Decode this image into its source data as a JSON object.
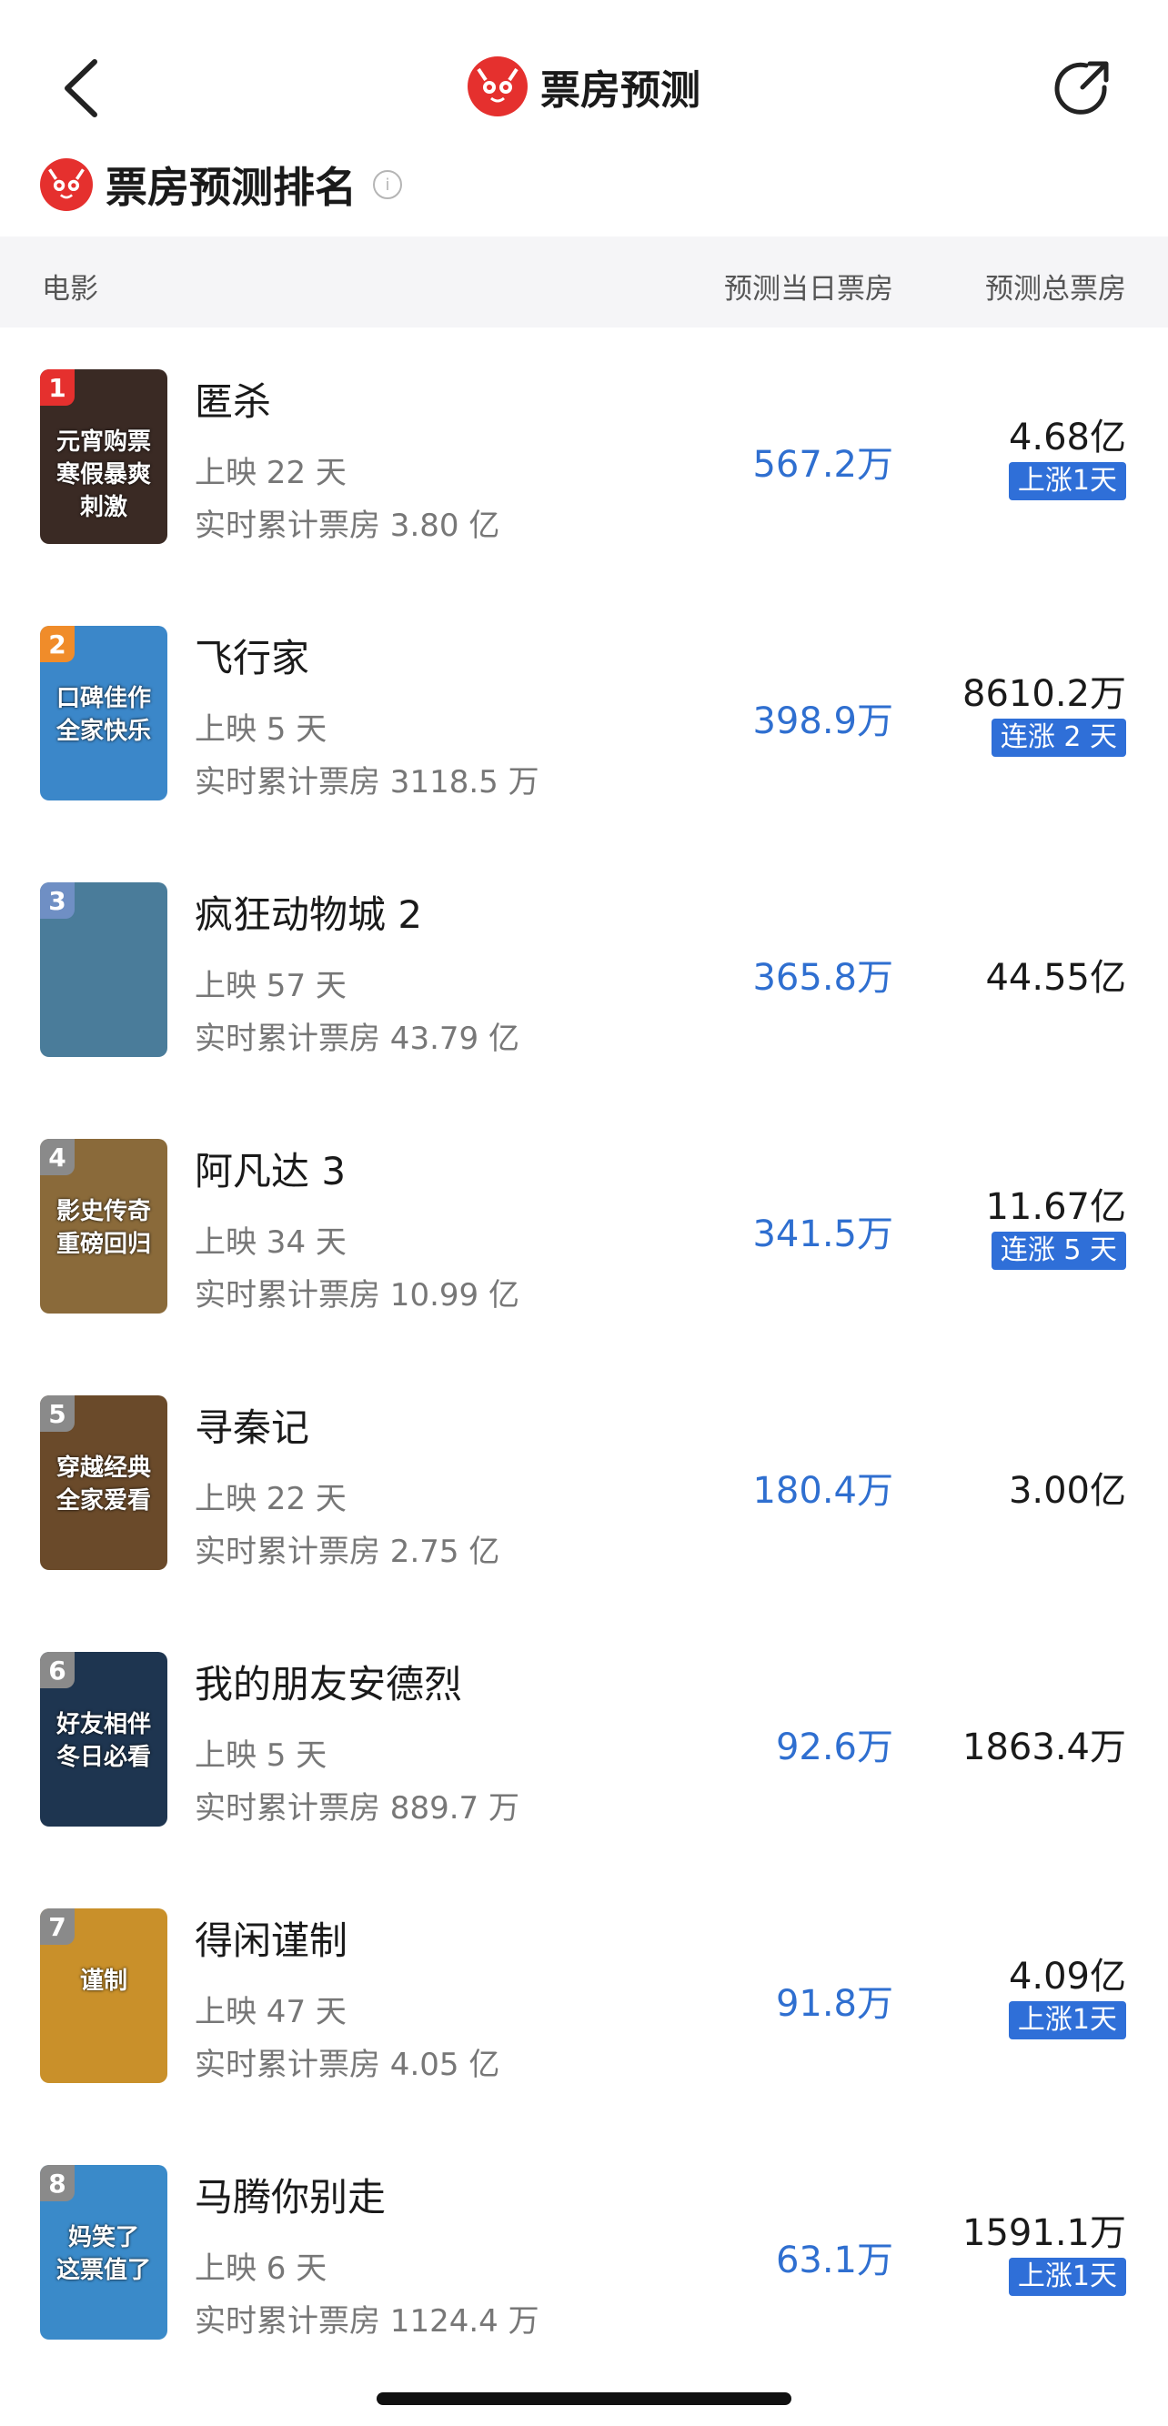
{
  "nav": {
    "title": "票房预测"
  },
  "section": {
    "title": "票房预测排名",
    "info": "i"
  },
  "columns": {
    "movie": "电影",
    "today": "预测当日票房",
    "total": "预测总票房"
  },
  "colors": {
    "accent": "#e5302e",
    "link_blue": "#2f6fd0",
    "badge_blue": "#2f6fd8"
  },
  "movies": [
    {
      "rank": "1",
      "title": "匿杀",
      "days": "上映 22 天",
      "cum": "实时累计票房 3.80 亿",
      "today": "567.2万",
      "total": "4.68亿",
      "badge": "上涨1天",
      "poster_text": "元宵购票\n寒假暴爽刺激",
      "rank_color": "#e5302e",
      "poster_bg": "#3a2a24"
    },
    {
      "rank": "2",
      "title": "飞行家",
      "days": "上映 5 天",
      "cum": "实时累计票房 3118.5 万",
      "today": "398.9万",
      "total": "8610.2万",
      "badge": "连涨 2 天",
      "poster_text": "口碑佳作\n全家快乐",
      "rank_color": "#f08c2a",
      "poster_bg": "#3b87c9"
    },
    {
      "rank": "3",
      "title": "疯狂动物城 2",
      "days": "上映 57 天",
      "cum": "实时累计票房 43.79 亿",
      "today": "365.8万",
      "total": "44.55亿",
      "badge": "",
      "poster_text": "",
      "rank_color": "#6f8fc4",
      "poster_bg": "#4a7c9a"
    },
    {
      "rank": "4",
      "title": "阿凡达 3",
      "days": "上映 34 天",
      "cum": "实时累计票房 10.99 亿",
      "today": "341.5万",
      "total": "11.67亿",
      "badge": "连涨 5 天",
      "poster_text": "影史传奇\n重磅回归",
      "rank_color": "#8a8a8a",
      "poster_bg": "#8a6a3a"
    },
    {
      "rank": "5",
      "title": "寻秦记",
      "days": "上映 22 天",
      "cum": "实时累计票房 2.75 亿",
      "today": "180.4万",
      "total": "3.00亿",
      "badge": "",
      "poster_text": "穿越经典\n全家爱看",
      "rank_color": "#8a8a8a",
      "poster_bg": "#6a4a2a"
    },
    {
      "rank": "6",
      "title": "我的朋友安德烈",
      "days": "上映 5 天",
      "cum": "实时累计票房 889.7 万",
      "today": "92.6万",
      "total": "1863.4万",
      "badge": "",
      "poster_text": "好友相伴\n冬日必看",
      "rank_color": "#8a8a8a",
      "poster_bg": "#1e3550"
    },
    {
      "rank": "7",
      "title": "得闲谨制",
      "days": "上映 47 天",
      "cum": "实时累计票房 4.05 亿",
      "today": "91.8万",
      "total": "4.09亿",
      "badge": "上涨1天",
      "poster_text": "谨制",
      "rank_color": "#8a8a8a",
      "poster_bg": "#c9902a"
    },
    {
      "rank": "8",
      "title": "马腾你别走",
      "days": "上映 6 天",
      "cum": "实时累计票房 1124.4 万",
      "today": "63.1万",
      "total": "1591.1万",
      "badge": "上涨1天",
      "poster_text": "妈笑了\n这票值了",
      "rank_color": "#8a8a8a",
      "poster_bg": "#3a8ac9"
    }
  ]
}
